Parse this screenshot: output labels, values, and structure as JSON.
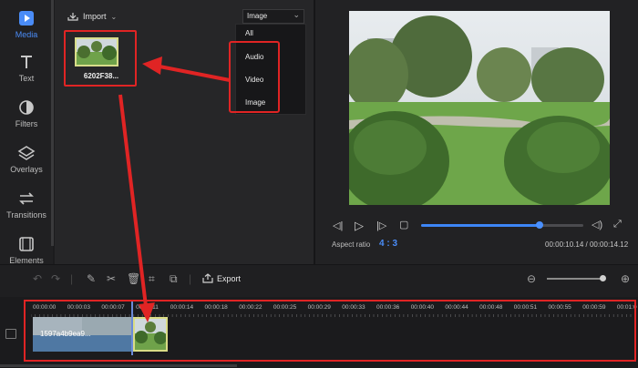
{
  "sidebar": {
    "items": [
      {
        "label": "Media",
        "icon": "media-icon",
        "active": true
      },
      {
        "label": "Text",
        "icon": "text-icon"
      },
      {
        "label": "Filters",
        "icon": "filters-icon"
      },
      {
        "label": "Overlays",
        "icon": "overlays-icon"
      },
      {
        "label": "Transitions",
        "icon": "transitions-icon"
      },
      {
        "label": "Elements",
        "icon": "elements-icon"
      }
    ]
  },
  "media": {
    "import_label": "Import",
    "filter_selected": "Image",
    "filter_options": [
      "All",
      "Audio",
      "Video",
      "Image"
    ],
    "thumbnail_name": "6202F38..."
  },
  "preview": {
    "aspect_label": "Aspect ratio",
    "aspect_value": "4 : 3",
    "time_current": "00:00:10.14",
    "time_total": "00:00:14.12",
    "time_separator": " / ",
    "progress_fraction": 0.73
  },
  "toolbar": {
    "export_label": "Export"
  },
  "timeline": {
    "ticks": [
      "00:00:00",
      "00:00:03",
      "00:00:07",
      "00:00:11",
      "00:00:14",
      "00:00:18",
      "00:00:22",
      "00:00:25",
      "00:00:29",
      "00:00:33",
      "00:00:36",
      "00:00:40",
      "00:00:44",
      "00:00:48",
      "00:00:51",
      "00:00:55",
      "00:00:59",
      "00:01:0"
    ],
    "video_clip_text": "1597a4b9ea9..."
  },
  "colors": {
    "accent": "#4a8cf7",
    "highlight_red": "#e02424",
    "clip_border": "#d9dc86"
  }
}
